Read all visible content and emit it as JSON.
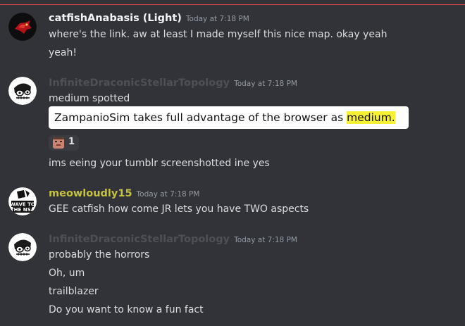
{
  "colors": {
    "background": "#313338",
    "divider": "#d2474d",
    "catfish_name": "#f2f3f5",
    "topology_name": "#4e5058",
    "meowloudly_name": "#c6c23b",
    "timestamp": "#949ba4",
    "text": "#dbdee1",
    "highlight": "#f7f135"
  },
  "messages": [
    {
      "author": "catfishAnabasis (Light)",
      "timestamp": "Today at 7:18 PM",
      "avatar_icon": "red-dragon-avatar",
      "lines": [
        "where's the link. aw at least I made myself this nice map. okay yeah",
        "yeah!"
      ]
    },
    {
      "author": "InfiniteDraconicStellarTopology",
      "timestamp": "Today at 7:18 PM",
      "avatar_icon": "skull-sketch-avatar",
      "lines": [
        "medium spotted"
      ],
      "quote": {
        "before": "ZampanioSim takes full advantage of the browser as ",
        "highlighted": "medium."
      },
      "reaction": {
        "emoji_icon": "face-emoji-icon",
        "count": "1"
      },
      "after_lines": [
        "ims eeing your tumblr screenshotted ine yes"
      ]
    },
    {
      "author": "meowloudly15",
      "timestamp": "Today at 7:18 PM",
      "avatar_icon": "wave-to-the-nsa-avatar",
      "avatar_text_1": "WAVE TO",
      "avatar_text_2": "THE NSA",
      "lines": [
        "GEE catfish how come JR lets you have TWO aspects"
      ]
    },
    {
      "author": "InfiniteDraconicStellarTopology",
      "timestamp": "Today at 7:18 PM",
      "avatar_icon": "skull-sketch-avatar",
      "lines": [
        "probably the horrors",
        "Oh, um",
        "trailblazer",
        "Do you want to know a fun fact"
      ]
    }
  ]
}
